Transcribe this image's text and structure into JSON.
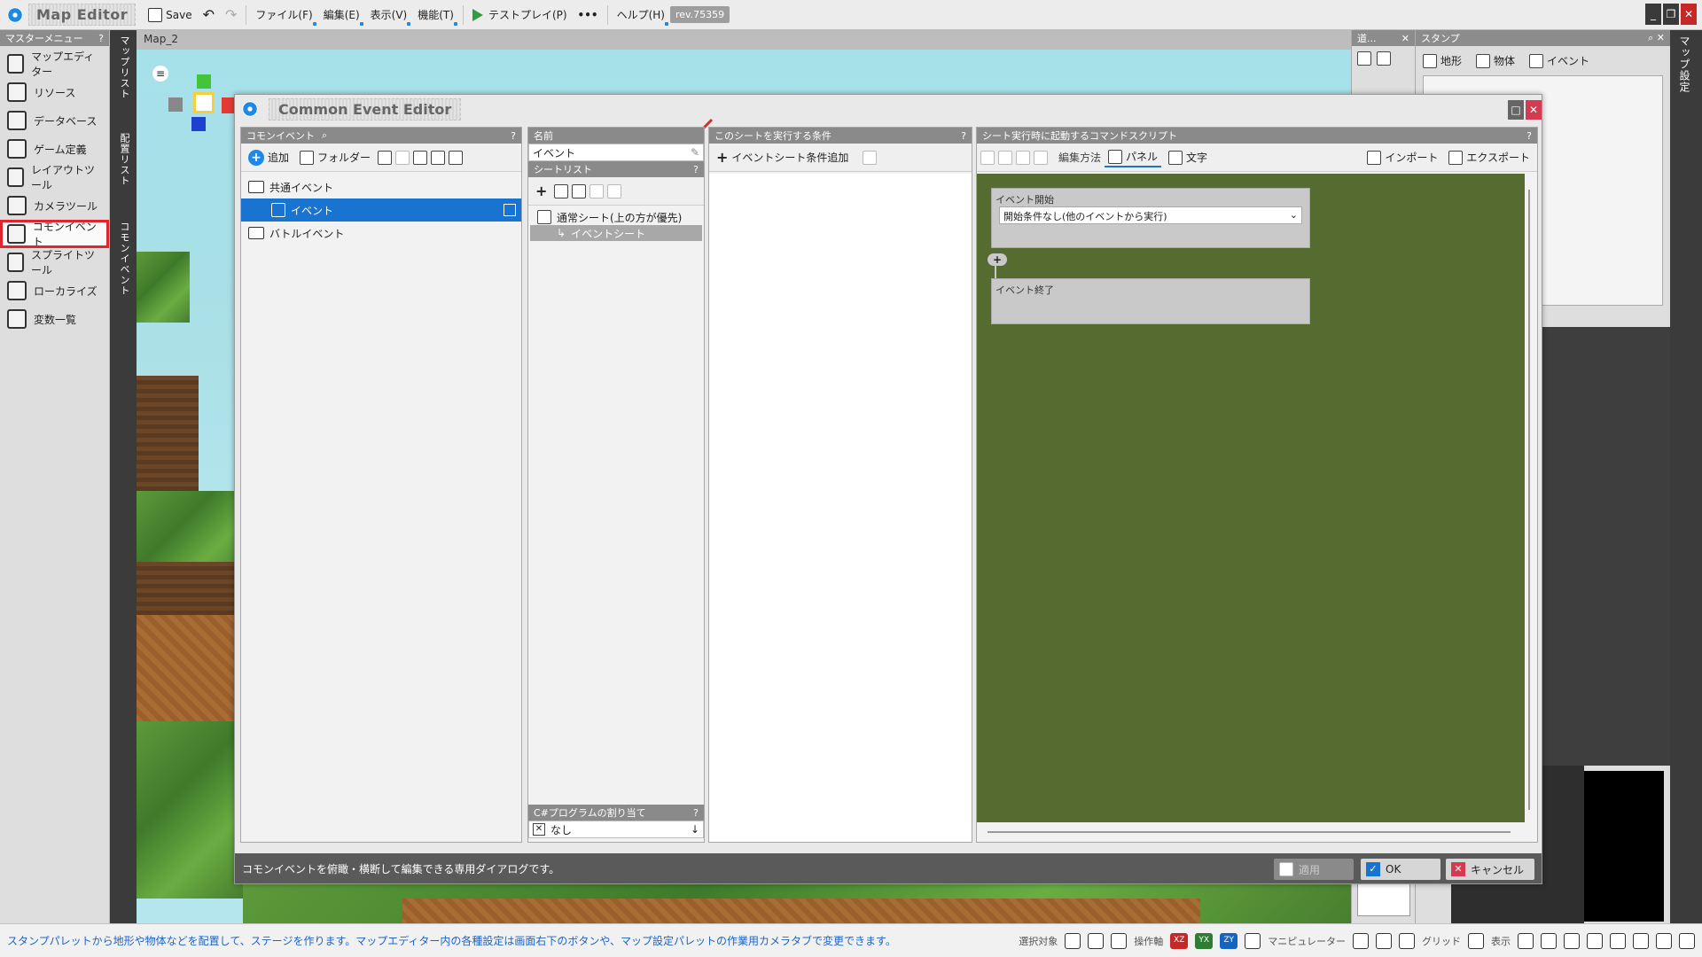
{
  "topbar": {
    "app_title": "Map Editor",
    "save_label": "Save",
    "menus": [
      "ファイル(F)",
      "編集(E)",
      "表示(V)",
      "機能(T)"
    ],
    "testplay_label": "テストプレイ(P)",
    "more_label": "•••",
    "help_label": "ヘルプ(H)",
    "revision": "rev.75359"
  },
  "master_menu": {
    "title": "マスターメニュー",
    "help": "?",
    "items": [
      {
        "label": "マップエディター",
        "icon": "map-editor-icon"
      },
      {
        "label": "リソース",
        "icon": "resource-icon"
      },
      {
        "label": "データベース",
        "icon": "database-icon"
      },
      {
        "label": "ゲーム定義",
        "icon": "game-definition-icon"
      },
      {
        "label": "レイアウトツール",
        "icon": "layout-tool-icon"
      },
      {
        "label": "カメラツール",
        "icon": "camera-tool-icon"
      },
      {
        "label": "コモンイベント",
        "icon": "common-event-icon",
        "active": true
      },
      {
        "label": "スプライトツール",
        "icon": "sprite-tool-icon"
      },
      {
        "label": "ローカライズ",
        "icon": "localize-icon"
      },
      {
        "label": "変数一覧",
        "icon": "variable-list-icon"
      }
    ]
  },
  "vertical_strip": {
    "labels": [
      "マップリスト",
      "配置リスト",
      "コモンイベント"
    ]
  },
  "viewport": {
    "tab_label": "Map_2"
  },
  "stamp_panel": {
    "small_title": "道...",
    "title": "スタンプ",
    "tabs": [
      "地形",
      "物体",
      "イベント"
    ],
    "right_vertical_label": "マップ設定"
  },
  "dialog": {
    "title": "Common Event Editor",
    "common_event_column": {
      "header": "コモンイベント",
      "help": "?",
      "tools": {
        "add": "追加",
        "folder": "フォルダー"
      },
      "tree": [
        {
          "label": "共通イベント",
          "type": "folder"
        },
        {
          "label": "イベント",
          "type": "event",
          "selected": true
        },
        {
          "label": "バトルイベント",
          "type": "folder"
        }
      ]
    },
    "name_column": {
      "header": "名前",
      "name_value": "イベント",
      "sheet_list_header": "シートリスト",
      "sheet_list_help": "?",
      "sheet_items": [
        {
          "label": "通常シート(上の方が優先)"
        },
        {
          "label": "イベントシート"
        }
      ],
      "csharp_header": "C#プログラムの割り当て",
      "csharp_help": "?",
      "csharp_value": "なし"
    },
    "condition_column": {
      "header": "このシートを実行する条件",
      "help": "?",
      "add_label": "イベントシート条件追加"
    },
    "script_column": {
      "header": "シート実行時に起動するコマンドスクリプト",
      "help": "?",
      "edit_method_label": "編集方法",
      "panel_label": "パネル",
      "text_label": "文字",
      "import_label": "インポート",
      "export_label": "エクスポート",
      "event_start": "イベント開始",
      "start_condition": "開始条件なし(他のイベントから実行)",
      "event_end": "イベント終了"
    },
    "status_text": "コモンイベントを俯瞰・横断して編集できる専用ダイアログです。",
    "buttons": {
      "apply": "適用",
      "ok": "OK",
      "cancel": "キャンセル"
    }
  },
  "bottom_bar": {
    "message": "スタンプパレットから地形や物体などを配置して、ステージを作ります。マップエディター内の各種設定は画面右下のボタンや、マップ設定パレットの作業用カメラタブで変更できます。",
    "labels": {
      "select_target": "選択対象",
      "operation_axis": "操作軸",
      "xz": "XZ",
      "yx": "YX",
      "zy": "ZY",
      "manipulator": "マニピュレーター",
      "grid": "グリッド",
      "display": "表示"
    }
  },
  "colors": {
    "accent": "#1874d0",
    "highlight_red": "#e0262b",
    "script_canvas": "#556b2f",
    "status_bar": "#5a5a5a"
  }
}
